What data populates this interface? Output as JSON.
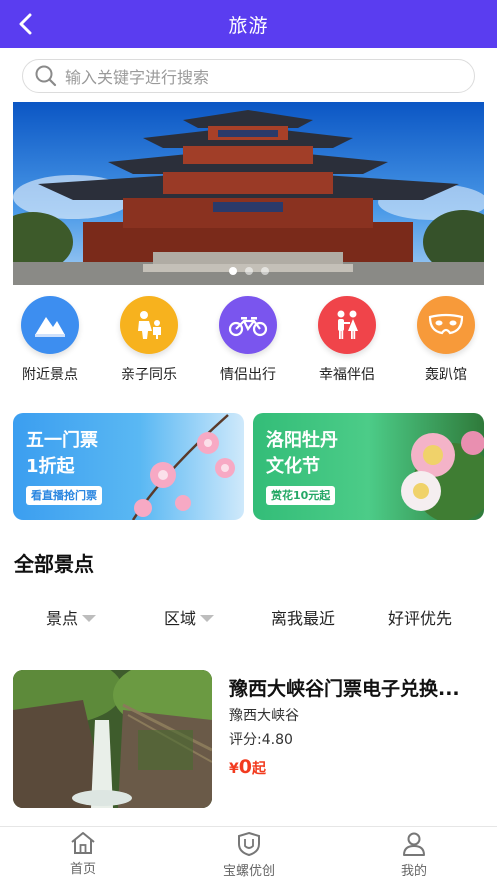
{
  "header": {
    "title": "旅游",
    "back_icon": "chevron-left-icon"
  },
  "search": {
    "placeholder": "输入关键字进行搜索",
    "icon": "search-icon"
  },
  "banner": {
    "slide_count": 3,
    "active_index": 0
  },
  "categories": [
    {
      "label": "附近景点",
      "icon": "mountain-icon",
      "color": "#3d8ef0"
    },
    {
      "label": "亲子同乐",
      "icon": "parent-child-icon",
      "color": "#f7b21e"
    },
    {
      "label": "情侣出行",
      "icon": "tandem-bike-icon",
      "color": "#7a55ee"
    },
    {
      "label": "幸福伴侣",
      "icon": "couple-icon",
      "color": "#f0444a"
    },
    {
      "label": "轰趴馆",
      "icon": "party-mask-icon",
      "color": "#f79a3a"
    }
  ],
  "promos": [
    {
      "line1": "五一门票",
      "line2": "1折起",
      "button": "看直播抢门票",
      "color_start": "#3fa2f0",
      "color_end": "#62c3f5",
      "accent": "#2a86e0"
    },
    {
      "line1": "洛阳牡丹",
      "line2": "文化节",
      "button": "赏花10元起",
      "color_start": "#35c07a",
      "color_end": "#55d08e",
      "accent": "#25a866"
    }
  ],
  "section": {
    "title": "全部景点"
  },
  "filters": [
    {
      "label": "景点",
      "dropdown": true
    },
    {
      "label": "区域",
      "dropdown": true
    },
    {
      "label": "离我最近",
      "dropdown": false
    },
    {
      "label": "好评优先",
      "dropdown": false
    }
  ],
  "listing": {
    "name": "豫西大峡谷门票电子兑换...",
    "location": "豫西大峡谷",
    "rating": "评分:4.80",
    "price_symbol": "¥",
    "price_value": "0",
    "price_suffix": "起"
  },
  "tabbar": [
    {
      "label": "首页",
      "icon": "home-icon"
    },
    {
      "label": "宝螺优创",
      "icon": "shield-icon"
    },
    {
      "label": "我的",
      "icon": "user-icon"
    }
  ],
  "colors": {
    "primary": "#5a3df0",
    "price": "#f23b1f"
  }
}
